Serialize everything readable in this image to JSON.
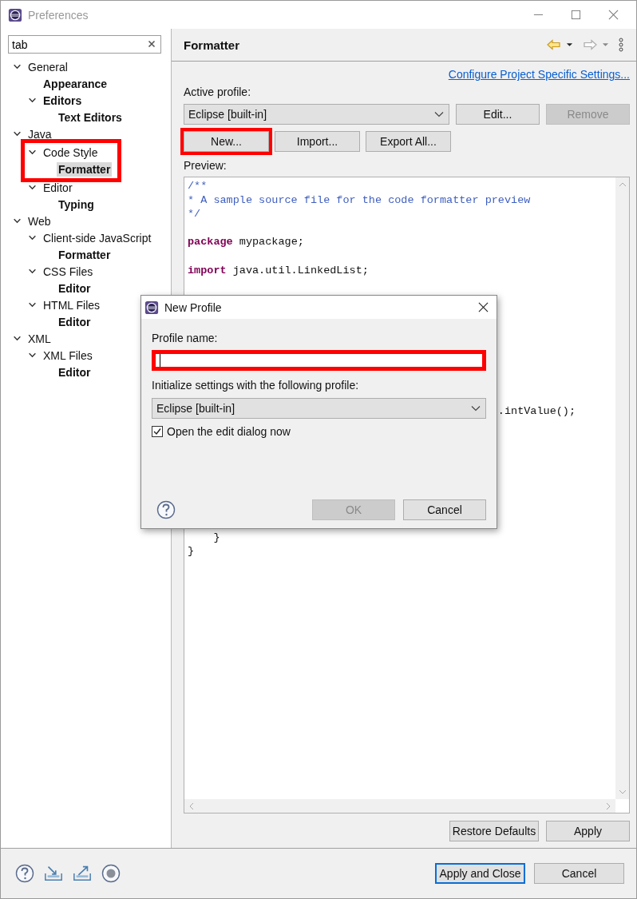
{
  "window": {
    "title": "Preferences"
  },
  "filter": {
    "value": "tab"
  },
  "tree": [
    {
      "label": "General",
      "expanded": true,
      "matched": false,
      "selected": false,
      "children": [
        {
          "label": "Appearance",
          "matched": true,
          "selected": false
        },
        {
          "label": "Editors",
          "expanded": true,
          "matched": true,
          "selected": false,
          "children": [
            {
              "label": "Text Editors",
              "matched": true,
              "selected": false
            }
          ]
        }
      ]
    },
    {
      "label": "Java",
      "expanded": true,
      "matched": false,
      "selected": false,
      "children": [
        {
          "label": "Code Style",
          "expanded": true,
          "matched": false,
          "selected": false,
          "highlighted": true,
          "children": [
            {
              "label": "Formatter",
              "matched": true,
              "selected": true
            }
          ]
        },
        {
          "label": "Editor",
          "expanded": true,
          "matched": false,
          "selected": false,
          "children": [
            {
              "label": "Typing",
              "matched": true,
              "selected": false
            }
          ]
        }
      ]
    },
    {
      "label": "Web",
      "expanded": true,
      "matched": false,
      "selected": false,
      "children": [
        {
          "label": "Client-side JavaScript",
          "expanded": true,
          "matched": false,
          "selected": false,
          "children": [
            {
              "label": "Formatter",
              "matched": true,
              "selected": false
            }
          ]
        },
        {
          "label": "CSS Files",
          "expanded": true,
          "matched": false,
          "selected": false,
          "children": [
            {
              "label": "Editor",
              "matched": true,
              "selected": false
            }
          ]
        },
        {
          "label": "HTML Files",
          "expanded": true,
          "matched": false,
          "selected": false,
          "children": [
            {
              "label": "Editor",
              "matched": true,
              "selected": false
            }
          ]
        }
      ]
    },
    {
      "label": "XML",
      "expanded": true,
      "matched": false,
      "selected": false,
      "children": [
        {
          "label": "XML Files",
          "expanded": true,
          "matched": false,
          "selected": false,
          "children": [
            {
              "label": "Editor",
              "matched": true,
              "selected": false
            }
          ]
        }
      ]
    }
  ],
  "page": {
    "title": "Formatter",
    "link": "Configure Project Specific Settings...",
    "active_profile_label": "Active profile:",
    "profile": "Eclipse [built-in]",
    "profile_buttons": [
      {
        "label": "Edit...",
        "disabled": false,
        "highlighted": false
      },
      {
        "label": "Remove",
        "disabled": true,
        "highlighted": false
      }
    ],
    "buttons": [
      {
        "label": "New...",
        "disabled": false,
        "highlighted": true
      },
      {
        "label": "Import...",
        "disabled": false,
        "highlighted": false
      },
      {
        "label": "Export All...",
        "disabled": false,
        "highlighted": false
      }
    ],
    "preview_label": "Preview:",
    "code": [
      {
        "kind": "code",
        "spans": [
          {
            "kind": "comment",
            "text": "/**"
          }
        ]
      },
      {
        "kind": "code",
        "spans": [
          {
            "kind": "comment",
            "text": "* A sample source file for the code formatter preview"
          }
        ]
      },
      {
        "kind": "code",
        "spans": [
          {
            "kind": "comment",
            "text": "*/"
          }
        ]
      },
      {
        "kind": "blank"
      },
      {
        "kind": "code",
        "spans": [
          {
            "kind": "keyword",
            "text": "package"
          },
          {
            "kind": "plain",
            "text": " mypackage;"
          }
        ]
      },
      {
        "kind": "blank"
      },
      {
        "kind": "code",
        "spans": [
          {
            "kind": "keyword",
            "text": "import"
          },
          {
            "kind": "plain",
            "text": " java.util.LinkedList;"
          }
        ]
      },
      {
        "kind": "blank"
      },
      {
        "kind": "blank"
      },
      {
        "kind": "blank"
      },
      {
        "kind": "blank"
      },
      {
        "kind": "blank"
      },
      {
        "kind": "blank"
      },
      {
        "kind": "blank"
      },
      {
        "kind": "blank"
      },
      {
        "kind": "blank"
      },
      {
        "kind": "tail",
        "spans": [
          {
            "kind": "plain",
            "text": ".intValue();"
          }
        ]
      },
      {
        "kind": "blank"
      },
      {
        "kind": "blank"
      },
      {
        "kind": "blank"
      },
      {
        "kind": "blank"
      },
      {
        "kind": "blank"
      },
      {
        "kind": "blank"
      },
      {
        "kind": "blank"
      },
      {
        "kind": "blank"
      },
      {
        "kind": "code",
        "spans": [
          {
            "kind": "plain",
            "text": "    }"
          }
        ]
      },
      {
        "kind": "code",
        "spans": [
          {
            "kind": "plain",
            "text": "}"
          }
        ]
      }
    ],
    "bottom_buttons": [
      {
        "label": "Restore Defaults",
        "default": false
      },
      {
        "label": "Apply",
        "default": false
      }
    ]
  },
  "footer_buttons": [
    {
      "label": "Apply and Close",
      "default": true
    },
    {
      "label": "Cancel",
      "default": false
    }
  ],
  "dialog": {
    "title": "New Profile",
    "name_label": "Profile name:",
    "name_highlighted": true,
    "init_label": "Initialize settings with the following profile:",
    "init_profile": "Eclipse [built-in]",
    "checkbox": {
      "label": "Open the edit dialog now",
      "checked": true
    },
    "buttons": [
      {
        "label": "OK",
        "disabled": true
      },
      {
        "label": "Cancel",
        "disabled": false
      }
    ]
  }
}
